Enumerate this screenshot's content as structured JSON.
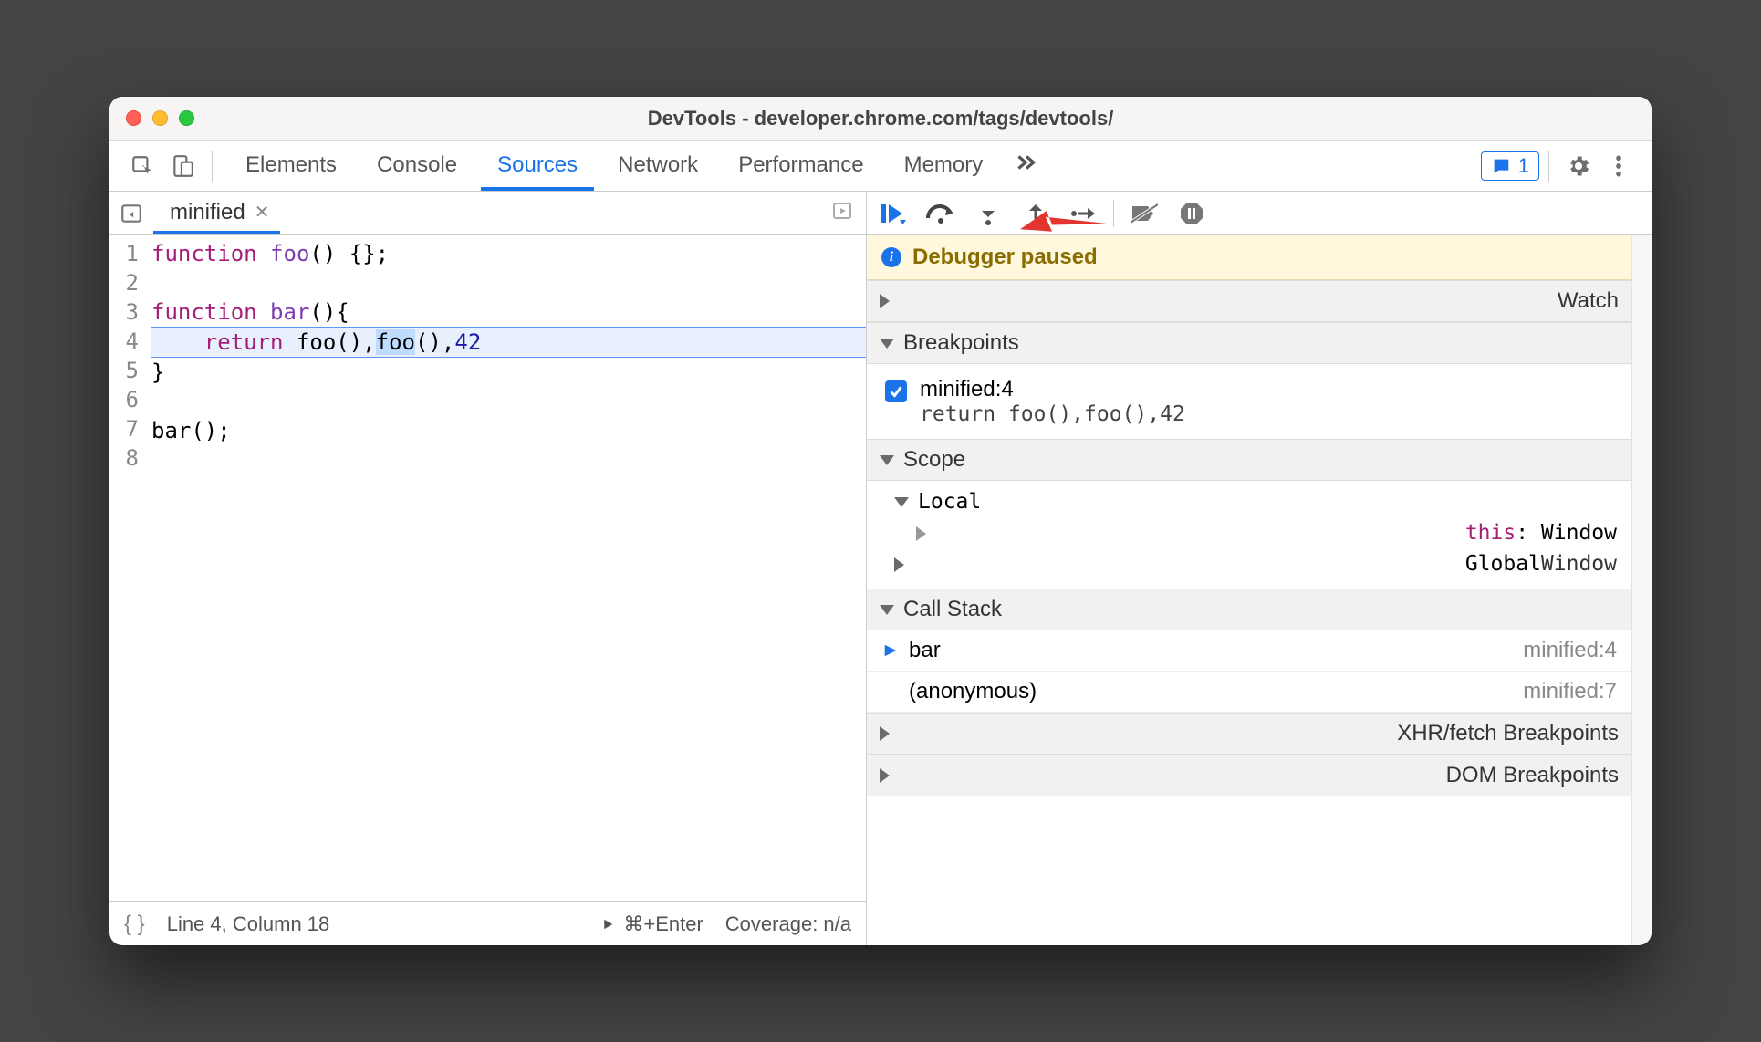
{
  "window": {
    "title": "DevTools - developer.chrome.com/tags/devtools/"
  },
  "tabs": [
    {
      "label": "Elements",
      "id": "elements"
    },
    {
      "label": "Console",
      "id": "console"
    },
    {
      "label": "Sources",
      "id": "sources",
      "active": true
    },
    {
      "label": "Network",
      "id": "network"
    },
    {
      "label": "Performance",
      "id": "performance"
    },
    {
      "label": "Memory",
      "id": "memory"
    }
  ],
  "issues_count": "1",
  "file_tab": {
    "name": "minified"
  },
  "code": {
    "lines": 8,
    "raw": [
      {
        "tokens": [
          {
            "t": "function ",
            "c": "kw"
          },
          {
            "t": "foo",
            "c": "fn"
          },
          {
            "t": "() {};"
          }
        ]
      },
      {
        "tokens": [
          {
            "t": ""
          }
        ]
      },
      {
        "tokens": [
          {
            "t": "function ",
            "c": "kw"
          },
          {
            "t": "bar",
            "c": "fn"
          },
          {
            "t": "(){"
          }
        ]
      },
      {
        "exec": true,
        "tokens": [
          {
            "t": "    "
          },
          {
            "t": "return ",
            "c": "kw"
          },
          {
            "t": "foo(),"
          },
          {
            "t": "foo",
            "hi": true
          },
          {
            "t": "(),"
          },
          {
            "t": "42",
            "c": "nm"
          }
        ]
      },
      {
        "tokens": [
          {
            "t": "}"
          }
        ]
      },
      {
        "tokens": [
          {
            "t": ""
          }
        ]
      },
      {
        "tokens": [
          {
            "t": "bar();"
          }
        ]
      },
      {
        "tokens": [
          {
            "t": ""
          }
        ]
      }
    ]
  },
  "statusbar": {
    "cursor": "Line 4, Column 18",
    "shortcut": "⌘+Enter",
    "coverage": "Coverage: n/a"
  },
  "debugger": {
    "paused_message": "Debugger paused",
    "sections": {
      "watch": "Watch",
      "breakpoints": "Breakpoints",
      "scope": "Scope",
      "callstack": "Call Stack",
      "xhr": "XHR/fetch Breakpoints",
      "dom": "DOM Breakpoints"
    },
    "breakpoint": {
      "checked": true,
      "title": "minified:4",
      "snippet": "return foo(),foo(),42"
    },
    "scope": {
      "local_label": "Local",
      "this_key": "this",
      "this_val": "Window",
      "global_label": "Global",
      "global_val": "Window"
    },
    "callstack": [
      {
        "fn": "bar",
        "loc": "minified:4",
        "current": true
      },
      {
        "fn": "(anonymous)",
        "loc": "minified:7",
        "current": false
      }
    ]
  }
}
